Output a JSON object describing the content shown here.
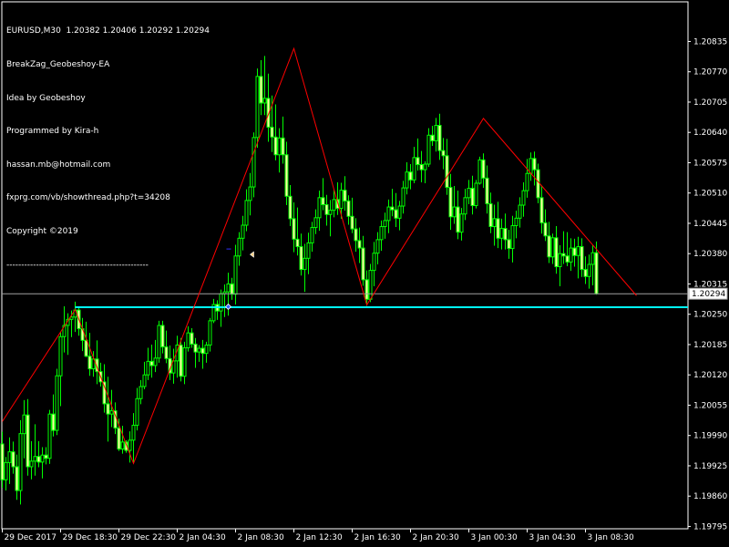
{
  "info": {
    "symbol_line": "EURUSD,M30  1.20382 1.20406 1.20292 1.20294",
    "ea_name": "BreakZag_Geobeshoy-EA",
    "idea": "Idea by Geobeshoy",
    "programmed": "Programmed by Kira-h",
    "email": "hassan.mb@hotmail.com",
    "url": "fxprg.com/vb/showthread.php?t=34208",
    "copyright": "Copyright ©2019",
    "separator": "------------------------------------------------"
  },
  "colors": {
    "background": "#000000",
    "axis": "#ffffff",
    "bull_candle": "#ffffa0",
    "bear_candle": "#000000",
    "candle_outline": "#00ff00",
    "zigzag": "#ff0000",
    "support_line": "#00ffff",
    "bid_line": "#a0a0a0"
  },
  "current_price_label": "1.20294",
  "chart_data": {
    "type": "candlestick",
    "title": "EURUSD,M30",
    "ylim": [
      1.1979,
      1.2092
    ],
    "y_ticks": [
      "1.20835",
      "1.20770",
      "1.20705",
      "1.20640",
      "1.20575",
      "1.20510",
      "1.20445",
      "1.20380",
      "1.20315",
      "1.20250",
      "1.20185",
      "1.20120",
      "1.20055",
      "1.19990",
      "1.19925",
      "1.19860",
      "1.19795"
    ],
    "x_ticks": [
      {
        "bar": 0,
        "label": "29 Dec 2017"
      },
      {
        "bar": 16,
        "label": "29 Dec 18:30"
      },
      {
        "bar": 32,
        "label": "29 Dec 22:30"
      },
      {
        "bar": 48,
        "label": "2 Jan 04:30"
      },
      {
        "bar": 64,
        "label": "2 Jan 08:30"
      },
      {
        "bar": 80,
        "label": "2 Jan 12:30"
      },
      {
        "bar": 96,
        "label": "2 Jan 16:30"
      },
      {
        "bar": 112,
        "label": "2 Jan 20:30"
      },
      {
        "bar": 128,
        "label": "3 Jan 00:30"
      },
      {
        "bar": 144,
        "label": "3 Jan 04:30"
      },
      {
        "bar": 160,
        "label": "3 Jan 08:30"
      }
    ],
    "last_price": 1.20294,
    "support_level": 1.20265,
    "zigzag": [
      {
        "bar": 0,
        "price": 1.2002
      },
      {
        "bar": 20,
        "price": 1.2026
      },
      {
        "bar": 36,
        "price": 1.1993
      },
      {
        "bar": 80,
        "price": 1.2082
      },
      {
        "bar": 100,
        "price": 1.2027
      },
      {
        "bar": 132,
        "price": 1.2067
      },
      {
        "bar": 174,
        "price": 1.2029
      }
    ],
    "candles": [
      [
        1.19972,
        1.19998,
        1.19878,
        1.19895
      ],
      [
        1.19895,
        1.19944,
        1.19872,
        1.19932
      ],
      [
        1.19932,
        1.19986,
        1.19886,
        1.19955
      ],
      [
        1.19955,
        1.19977,
        1.19908,
        1.19923
      ],
      [
        1.19923,
        1.19949,
        1.19852,
        1.19872
      ],
      [
        1.19872,
        1.20023,
        1.19842,
        1.19994
      ],
      [
        1.19994,
        1.20066,
        1.19941,
        1.20034
      ],
      [
        1.20034,
        1.20068,
        1.19904,
        1.19923
      ],
      [
        1.19923,
        1.19978,
        1.19896,
        1.19935
      ],
      [
        1.19935,
        1.20014,
        1.19904,
        1.19945
      ],
      [
        1.19945,
        1.19978,
        1.19922,
        1.19933
      ],
      [
        1.19933,
        1.19965,
        1.19898,
        1.19948
      ],
      [
        1.19948,
        1.19965,
        1.19928,
        1.19941
      ],
      [
        1.19941,
        1.20045,
        1.19929,
        1.20036
      ],
      [
        1.20036,
        1.20078,
        1.19988,
        1.20001
      ],
      [
        1.20001,
        1.20133,
        1.19991,
        1.20118
      ],
      [
        1.20118,
        1.20212,
        1.20053,
        1.20202
      ],
      [
        1.20202,
        1.20267,
        1.20168,
        1.20226
      ],
      [
        1.20226,
        1.20252,
        1.20163,
        1.20239
      ],
      [
        1.20239,
        1.20258,
        1.20201,
        1.20244
      ],
      [
        1.20244,
        1.20277,
        1.20212,
        1.20259
      ],
      [
        1.20259,
        1.20267,
        1.20204,
        1.20219
      ],
      [
        1.20219,
        1.20242,
        1.20171,
        1.20194
      ],
      [
        1.20194,
        1.20234,
        1.20158,
        1.2016
      ],
      [
        1.2016,
        1.2021,
        1.20118,
        1.20133
      ],
      [
        1.20133,
        1.20171,
        1.20116,
        1.20154
      ],
      [
        1.20154,
        1.20194,
        1.201,
        1.20127
      ],
      [
        1.20127,
        1.20146,
        1.20095,
        1.20105
      ],
      [
        1.20105,
        1.20143,
        1.20039,
        1.20058
      ],
      [
        1.20058,
        1.20116,
        1.19977,
        1.20036
      ],
      [
        1.20036,
        1.20088,
        1.20008,
        1.20043
      ],
      [
        1.20043,
        1.20061,
        1.19993,
        1.20006
      ],
      [
        1.20006,
        1.20026,
        1.19957,
        1.19961
      ],
      [
        1.19961,
        1.20011,
        1.19951,
        1.19976
      ],
      [
        1.19976,
        1.1998,
        1.19953,
        1.19958
      ],
      [
        1.19958,
        1.19999,
        1.19932,
        1.1998
      ],
      [
        1.1998,
        1.20038,
        1.19932,
        1.20012
      ],
      [
        1.20012,
        1.20092,
        1.20001,
        1.20069
      ],
      [
        1.20069,
        1.20109,
        1.20057,
        1.20095
      ],
      [
        1.20095,
        1.20148,
        1.20089,
        1.2012
      ],
      [
        1.2012,
        1.20178,
        1.20109,
        1.20149
      ],
      [
        1.20149,
        1.20185,
        1.20114,
        1.2014
      ],
      [
        1.2014,
        1.20195,
        1.20126,
        1.20156
      ],
      [
        1.20156,
        1.20236,
        1.20146,
        1.20226
      ],
      [
        1.20226,
        1.20236,
        1.20166,
        1.2018
      ],
      [
        1.2018,
        1.20215,
        1.20145,
        1.20155
      ],
      [
        1.20155,
        1.20183,
        1.20109,
        1.20124
      ],
      [
        1.20124,
        1.20176,
        1.20101,
        1.2015
      ],
      [
        1.2015,
        1.20204,
        1.20114,
        1.20184
      ],
      [
        1.20184,
        1.20199,
        1.20106,
        1.20117
      ],
      [
        1.20117,
        1.20191,
        1.201,
        1.20178
      ],
      [
        1.20178,
        1.20224,
        1.2017,
        1.2021
      ],
      [
        1.2021,
        1.2022,
        1.20178,
        1.20186
      ],
      [
        1.20186,
        1.20199,
        1.20135,
        1.20169
      ],
      [
        1.20169,
        1.20184,
        1.20148,
        1.20177
      ],
      [
        1.20177,
        1.20195,
        1.20133,
        1.20166
      ],
      [
        1.20166,
        1.20191,
        1.20146,
        1.20184
      ],
      [
        1.20184,
        1.20242,
        1.2017,
        1.20236
      ],
      [
        1.20236,
        1.20283,
        1.20231,
        1.20271
      ],
      [
        1.20271,
        1.2028,
        1.20238,
        1.20257
      ],
      [
        1.20257,
        1.20303,
        1.20223,
        1.20294
      ],
      [
        1.20294,
        1.20314,
        1.20244,
        1.20298
      ],
      [
        1.20298,
        1.20339,
        1.20247,
        1.20315
      ],
      [
        1.20315,
        1.20328,
        1.20281,
        1.20293
      ],
      [
        1.20293,
        1.20399,
        1.20271,
        1.20375
      ],
      [
        1.20375,
        1.20426,
        1.20354,
        1.20413
      ],
      [
        1.20413,
        1.20461,
        1.20387,
        1.20441
      ],
      [
        1.20441,
        1.20518,
        1.20428,
        1.20494
      ],
      [
        1.20494,
        1.20553,
        1.20462,
        1.20523
      ],
      [
        1.20523,
        1.2064,
        1.20501,
        1.20629
      ],
      [
        1.20629,
        1.20777,
        1.20607,
        1.2076
      ],
      [
        1.2076,
        1.20795,
        1.20677,
        1.20703
      ],
      [
        1.20703,
        1.20804,
        1.20677,
        1.20713
      ],
      [
        1.20713,
        1.20766,
        1.2062,
        1.20651
      ],
      [
        1.20651,
        1.20719,
        1.20598,
        1.2063
      ],
      [
        1.2063,
        1.207,
        1.2058,
        1.20592
      ],
      [
        1.20592,
        1.20649,
        1.20554,
        1.20628
      ],
      [
        1.20628,
        1.20674,
        1.20573,
        1.20592
      ],
      [
        1.20592,
        1.2062,
        1.20484,
        1.20503
      ],
      [
        1.20503,
        1.20527,
        1.20439,
        1.20455
      ],
      [
        1.20455,
        1.2049,
        1.20383,
        1.20411
      ],
      [
        1.20411,
        1.20479,
        1.20376,
        1.20395
      ],
      [
        1.20395,
        1.20423,
        1.20333,
        1.20346
      ],
      [
        1.20346,
        1.20401,
        1.20298,
        1.2037
      ],
      [
        1.2037,
        1.20425,
        1.20336,
        1.20403
      ],
      [
        1.20403,
        1.20448,
        1.20384,
        1.20436
      ],
      [
        1.20436,
        1.20475,
        1.20422,
        1.20457
      ],
      [
        1.20457,
        1.20515,
        1.20429,
        1.205
      ],
      [
        1.205,
        1.20542,
        1.20473,
        1.20485
      ],
      [
        1.20485,
        1.20506,
        1.2044,
        1.20464
      ],
      [
        1.20464,
        1.20495,
        1.20417,
        1.20473
      ],
      [
        1.20473,
        1.20518,
        1.20458,
        1.20496
      ],
      [
        1.20496,
        1.20533,
        1.20463,
        1.20477
      ],
      [
        1.20477,
        1.20532,
        1.20455,
        1.20516
      ],
      [
        1.20516,
        1.20546,
        1.20472,
        1.20493
      ],
      [
        1.20493,
        1.20505,
        1.20442,
        1.2046
      ],
      [
        1.2046,
        1.205,
        1.20424,
        1.20433
      ],
      [
        1.20433,
        1.20456,
        1.20384,
        1.20408
      ],
      [
        1.20408,
        1.20436,
        1.2036,
        1.20392
      ],
      [
        1.20392,
        1.20418,
        1.20311,
        1.20324
      ],
      [
        1.20324,
        1.20344,
        1.20268,
        1.20282
      ],
      [
        1.20282,
        1.20358,
        1.20276,
        1.20344
      ],
      [
        1.20344,
        1.20405,
        1.2031,
        1.20381
      ],
      [
        1.20381,
        1.20426,
        1.20357,
        1.2041
      ],
      [
        1.2041,
        1.20451,
        1.20386,
        1.20438
      ],
      [
        1.20438,
        1.20468,
        1.20412,
        1.20451
      ],
      [
        1.20451,
        1.20496,
        1.20424,
        1.2048
      ],
      [
        1.2048,
        1.20519,
        1.2046,
        1.20474
      ],
      [
        1.20474,
        1.2051,
        1.20437,
        1.20456
      ],
      [
        1.20456,
        1.20493,
        1.2043,
        1.20482
      ],
      [
        1.20482,
        1.20536,
        1.20466,
        1.20521
      ],
      [
        1.20521,
        1.20576,
        1.20507,
        1.20555
      ],
      [
        1.20555,
        1.20572,
        1.20518,
        1.20538
      ],
      [
        1.20538,
        1.20609,
        1.20531,
        1.20586
      ],
      [
        1.20586,
        1.20627,
        1.20558,
        1.20571
      ],
      [
        1.20571,
        1.206,
        1.20533,
        1.2056
      ],
      [
        1.2056,
        1.20578,
        1.20531,
        1.20572
      ],
      [
        1.20572,
        1.20649,
        1.20566,
        1.20634
      ],
      [
        1.20634,
        1.20654,
        1.20611,
        1.20622
      ],
      [
        1.20622,
        1.20671,
        1.20599,
        1.20655
      ],
      [
        1.20655,
        1.2068,
        1.20581,
        1.20601
      ],
      [
        1.20601,
        1.20628,
        1.20561,
        1.2059
      ],
      [
        1.2059,
        1.20626,
        1.20506,
        1.20522
      ],
      [
        1.20522,
        1.20551,
        1.20431,
        1.20459
      ],
      [
        1.20459,
        1.20525,
        1.20444,
        1.2048
      ],
      [
        1.2048,
        1.20515,
        1.20411,
        1.20426
      ],
      [
        1.20426,
        1.20478,
        1.20408,
        1.20465
      ],
      [
        1.20465,
        1.20519,
        1.20452,
        1.205
      ],
      [
        1.205,
        1.20538,
        1.20486,
        1.2052
      ],
      [
        1.2052,
        1.20547,
        1.20464,
        1.20483
      ],
      [
        1.20483,
        1.20538,
        1.20477,
        1.20531
      ],
      [
        1.20531,
        1.20588,
        1.20528,
        1.20581
      ],
      [
        1.20581,
        1.20595,
        1.20521,
        1.20542
      ],
      [
        1.20542,
        1.20569,
        1.20466,
        1.20487
      ],
      [
        1.20487,
        1.20511,
        1.20424,
        1.20438
      ],
      [
        1.20438,
        1.20485,
        1.20397,
        1.20455
      ],
      [
        1.20455,
        1.20491,
        1.20392,
        1.20413
      ],
      [
        1.20413,
        1.20455,
        1.20389,
        1.20434
      ],
      [
        1.20434,
        1.20466,
        1.20389,
        1.2041
      ],
      [
        1.2041,
        1.20431,
        1.20369,
        1.20391
      ],
      [
        1.20391,
        1.20461,
        1.20361,
        1.2044
      ],
      [
        1.2044,
        1.20472,
        1.20413,
        1.20456
      ],
      [
        1.20456,
        1.20501,
        1.20436,
        1.20484
      ],
      [
        1.20484,
        1.20533,
        1.20459,
        1.20515
      ],
      [
        1.20515,
        1.20583,
        1.205,
        1.20552
      ],
      [
        1.20552,
        1.20597,
        1.20536,
        1.20584
      ],
      [
        1.20584,
        1.20599,
        1.20526,
        1.2056
      ],
      [
        1.2056,
        1.20573,
        1.20488,
        1.205
      ],
      [
        1.205,
        1.20524,
        1.20423,
        1.20446
      ],
      [
        1.20446,
        1.20475,
        1.20407,
        1.20418
      ],
      [
        1.20418,
        1.20448,
        1.2036,
        1.20373
      ],
      [
        1.20373,
        1.20423,
        1.20358,
        1.20414
      ],
      [
        1.20414,
        1.20439,
        1.20337,
        1.20352
      ],
      [
        1.20352,
        1.20398,
        1.2031,
        1.2038
      ],
      [
        1.2038,
        1.20428,
        1.20358,
        1.20375
      ],
      [
        1.20375,
        1.20426,
        1.20353,
        1.20362
      ],
      [
        1.20362,
        1.20413,
        1.20343,
        1.20392
      ],
      [
        1.20392,
        1.20412,
        1.20352,
        1.20376
      ],
      [
        1.20376,
        1.20416,
        1.20327,
        1.20395
      ],
      [
        1.20395,
        1.20413,
        1.2033,
        1.20346
      ],
      [
        1.20346,
        1.20374,
        1.20315,
        1.20331
      ],
      [
        1.20331,
        1.20378,
        1.20305,
        1.20357
      ],
      [
        1.20357,
        1.20398,
        1.20312,
        1.20382
      ],
      [
        1.20382,
        1.20406,
        1.20292,
        1.20294
      ]
    ]
  }
}
